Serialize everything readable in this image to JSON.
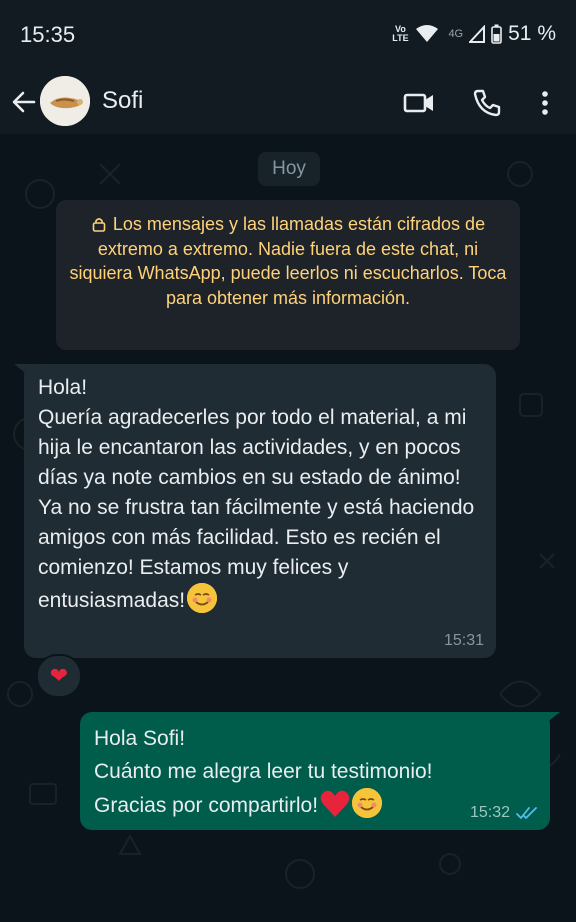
{
  "status_bar": {
    "time": "15:35",
    "volte_top": "Vo",
    "volte_bottom": "LTE",
    "network": "4G",
    "battery": "51 %"
  },
  "header": {
    "contact_name": "Sofi",
    "icons": [
      "back-arrow-icon",
      "video-call-icon",
      "voice-call-icon",
      "more-options-icon"
    ]
  },
  "chat": {
    "date_chip": "Hoy",
    "encryption_notice": "Los mensajes y las llamadas están cifrados de extremo a extremo. Nadie fuera de este chat, ni siquiera WhatsApp, puede leerlos ni escucharlos. Toca para obtener más información.",
    "messages": [
      {
        "direction": "incoming",
        "text": "Hola!\nQuería agradecerles por todo el material,  a mi hija le encantaron las actividades, y en pocos días ya note cambios en su estado de ánimo! Ya no se frustra tan fácilmente y está haciendo amigos con más facilidad. Esto es recién el comienzo! Estamos muy felices y entusiasmadas!",
        "time": "15:31",
        "reaction": "❤"
      },
      {
        "direction": "outgoing",
        "text": "Hola Sofi!\nCuánto me alegra leer tu testimonio!\nGracias por compartirlo!",
        "time": "15:32",
        "status": "read"
      }
    ]
  },
  "colors": {
    "background": "#0b141a",
    "incoming_bubble": "#202c33",
    "outgoing_bubble": "#005c4b",
    "encryption_text": "#ffd279",
    "read_ticks": "#53bdeb",
    "heart": "#e8243c"
  }
}
